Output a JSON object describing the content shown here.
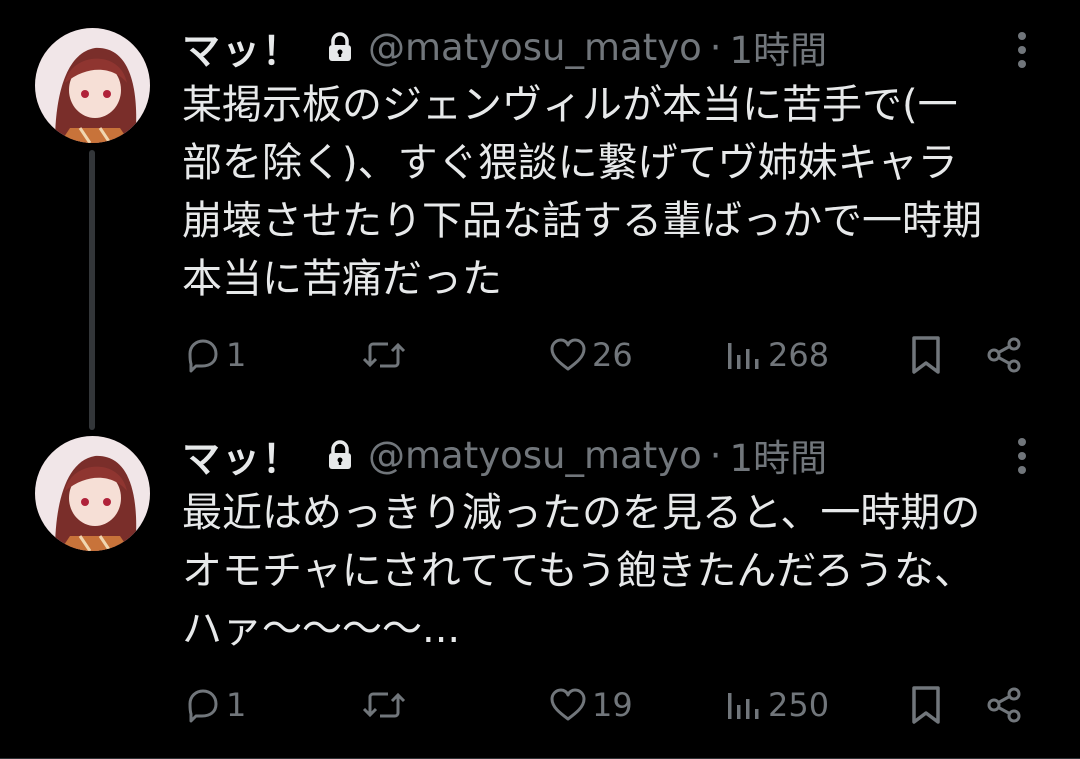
{
  "tweets": [
    {
      "author": {
        "display_name": "マッ！",
        "handle": "@matyosu_matyo",
        "protected_icon": "lock-icon"
      },
      "separator": "·",
      "time": "1時間",
      "text_lines": [
        "某掲示板のジェンヴィルが本当に苦手で(一",
        "部を除く)、すぐ猥談に繋げてヴ姉妹キャラ",
        "崩壊させたり下品な話する輩ばっかで一時期",
        "本当に苦痛だった"
      ],
      "stats": {
        "replies": "1",
        "retweets": "",
        "likes": "26",
        "views": "268"
      }
    },
    {
      "author": {
        "display_name": "マッ！",
        "handle": "@matyosu_matyo",
        "protected_icon": "lock-icon"
      },
      "separator": "·",
      "time": "1時間",
      "text_lines": [
        "最近はめっきり減ったのを見ると、一時期の",
        "オモチャにされててもう飽きたんだろうな、",
        "ハァ〜〜〜〜..."
      ],
      "stats": {
        "replies": "1",
        "retweets": "",
        "likes": "19",
        "views": "250"
      }
    }
  ],
  "icons": {
    "reply": "reply-icon",
    "retweet": "retweet-icon",
    "like": "heart-icon",
    "views": "views-icon",
    "bookmark": "bookmark-icon",
    "share": "share-icon",
    "more": "more-vertical-icon"
  },
  "colors": {
    "background": "#000000",
    "primary_text": "#e7e9ea",
    "secondary_text": "#71767b",
    "thread_line": "#333639"
  }
}
